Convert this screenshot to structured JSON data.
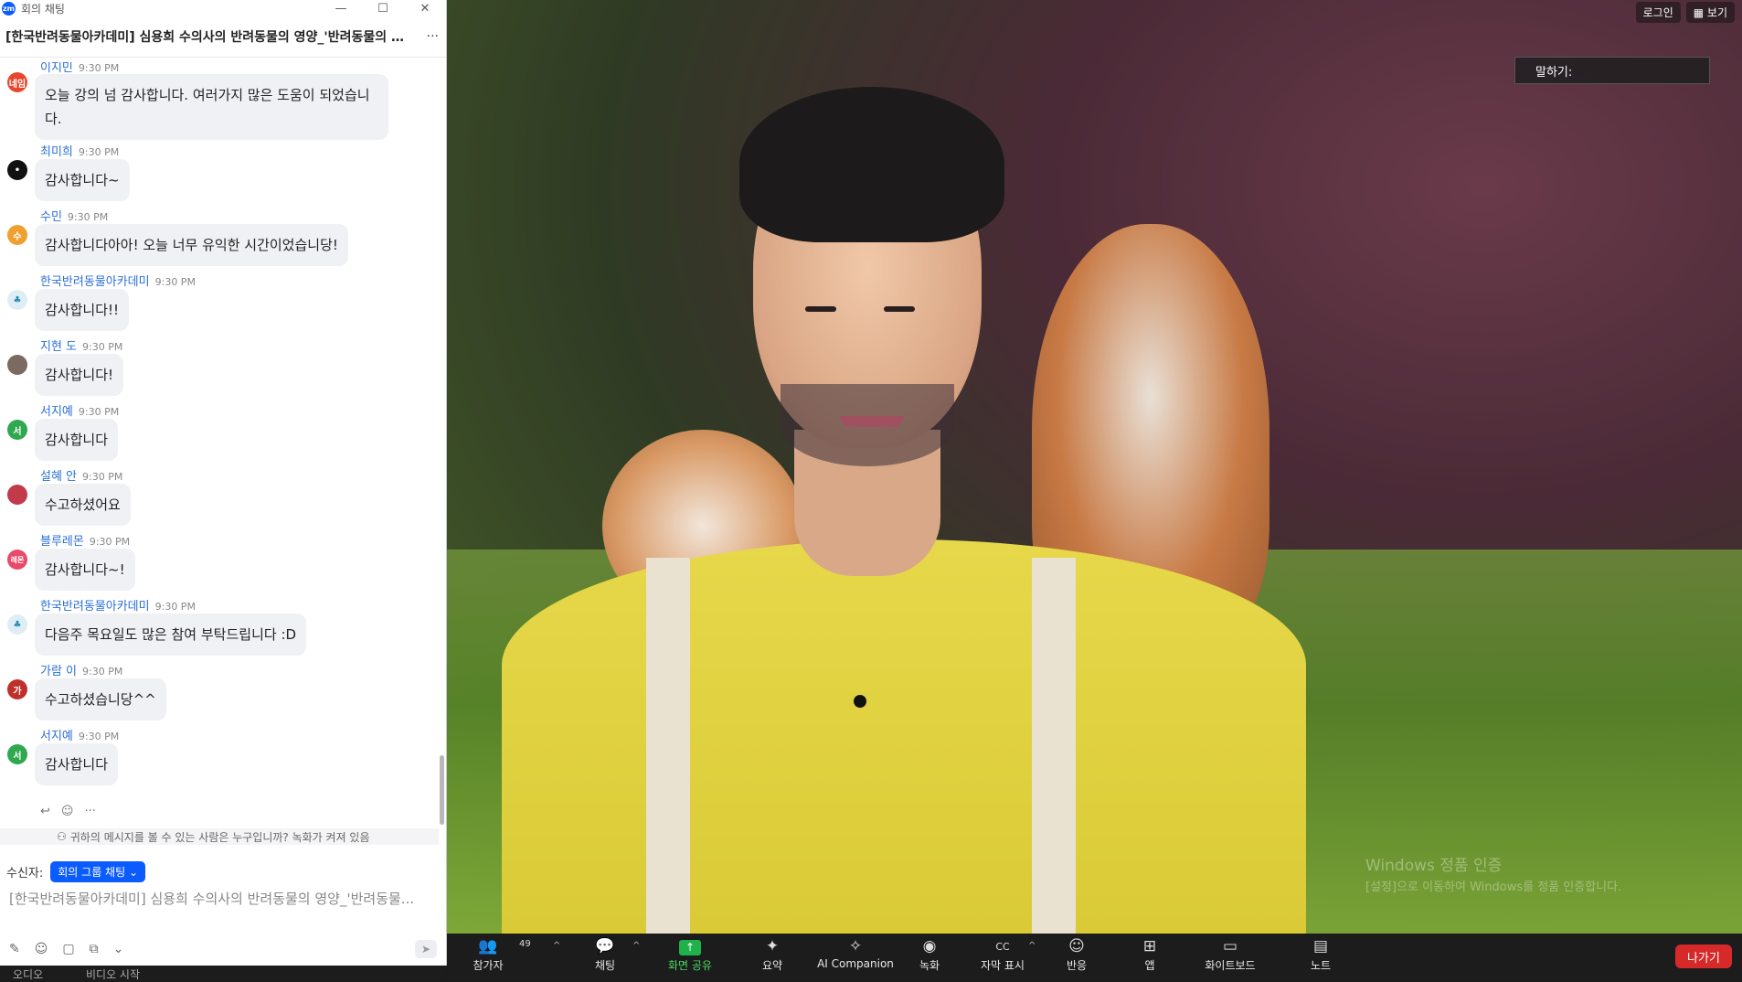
{
  "window": {
    "app_logo": "zm",
    "title": "회의 채팅",
    "buttons": [
      "—",
      "☐",
      "✕"
    ]
  },
  "chat": {
    "header_title": "[한국반려동물아카데미] 심용희 수의사의 반려동물의 영양_'반려동물의 소...",
    "more": "···",
    "messages": [
      {
        "name": "이지민",
        "time": "9:30 PM",
        "text": "오늘 강의 넘 감사합니다. 여러가지 많은 도움이 되었습니다.",
        "avatar_text": "네임",
        "avatar_color": "#e8472f"
      },
      {
        "name": "최미희",
        "time": "9:30 PM",
        "text": "감사합니다~",
        "avatar_text": "•",
        "avatar_color": "#111111"
      },
      {
        "name": "수민",
        "time": "9:30 PM",
        "text": "감사합니다아아! 오늘 너무 유익한 시간이었습니당!",
        "avatar_text": "수",
        "avatar_color": "#f0a030"
      },
      {
        "name": "한국반려동물아카데미",
        "time": "9:30 PM",
        "text": "감사합니다!!",
        "avatar_text": "♣",
        "avatar_color": "#dfeef5"
      },
      {
        "name": "지현 도",
        "time": "9:30 PM",
        "text": "감사합니다!",
        "avatar_text": "",
        "avatar_color": "#7a6a60"
      },
      {
        "name": "서지예",
        "time": "9:30 PM",
        "text": "감사합니다",
        "avatar_text": "서",
        "avatar_color": "#2fa84f"
      },
      {
        "name": "설혜 안",
        "time": "9:30 PM",
        "text": "수고하셨어요",
        "avatar_text": "",
        "avatar_color": "#c23a4a"
      },
      {
        "name": "블루레몬",
        "time": "9:30 PM",
        "text": "감사합니다~!",
        "avatar_text": "레몬",
        "avatar_color": "#e84a6a"
      },
      {
        "name": "한국반려동물아카데미",
        "time": "9:30 PM",
        "text": "다음주 목요일도 많은 참여 부탁드립니다 :D",
        "avatar_text": "♣",
        "avatar_color": "#dfeef5"
      },
      {
        "name": "가람 이",
        "time": "9:30 PM",
        "text": "수고하셨습니당^^",
        "avatar_text": "가",
        "avatar_color": "#c0302a"
      },
      {
        "name": "서지예",
        "time": "9:30 PM",
        "text": "감사합니다",
        "avatar_text": "서",
        "avatar_color": "#2fa84f"
      }
    ],
    "reaction_icons": [
      "↩",
      "☺",
      "···"
    ],
    "notice": "귀하의 메시지를 볼 수 있는 사람은 누구입니까? 녹화가 켜져 있음",
    "recipient_label": "수신자:",
    "recipient_value": "회의 그룹 채팅",
    "input_placeholder": "[한국반려동물아카데미] 심용희 수의사의 반려동물의 영양_'반려동물...",
    "tool_icons": [
      "✎",
      "☺",
      "▢",
      "⧉",
      "⌄"
    ],
    "send_icon": "➤"
  },
  "video": {
    "top_buttons": [
      "로그인",
      "▦ 보기"
    ],
    "speaking_label": "말하기:",
    "watermark_line1": "Windows 정품 인증",
    "watermark_line2": "[설정]으로 이동하여 Windows를 정품 인증합니다."
  },
  "toolbar": {
    "items": [
      {
        "label": "참가자",
        "icon": "👥",
        "badge": "49",
        "caret": true
      },
      {
        "label": "채팅",
        "icon": "💬",
        "caret": true
      },
      {
        "label": "화면 공유",
        "icon": "↑",
        "green": true
      },
      {
        "label": "요약",
        "icon": "✦"
      },
      {
        "label": "AI Companion",
        "icon": "✧"
      },
      {
        "label": "녹화",
        "icon": "◉"
      },
      {
        "label": "자막 표시",
        "icon": "CC",
        "caret": true
      },
      {
        "label": "반응",
        "icon": "☺"
      },
      {
        "label": "앱",
        "icon": "⊞"
      },
      {
        "label": "화이트보드",
        "icon": "▭"
      },
      {
        "label": "노트",
        "icon": "▤"
      }
    ],
    "leave_label": "나가기"
  },
  "under_strip": {
    "left_label": "오디오",
    "right_label": "비디오 시작"
  },
  "colors": {
    "accent": "#0b5cff",
    "name_blue": "#2b6fd6",
    "leave_red": "#d62a2a",
    "share_green": "#20b24a"
  }
}
